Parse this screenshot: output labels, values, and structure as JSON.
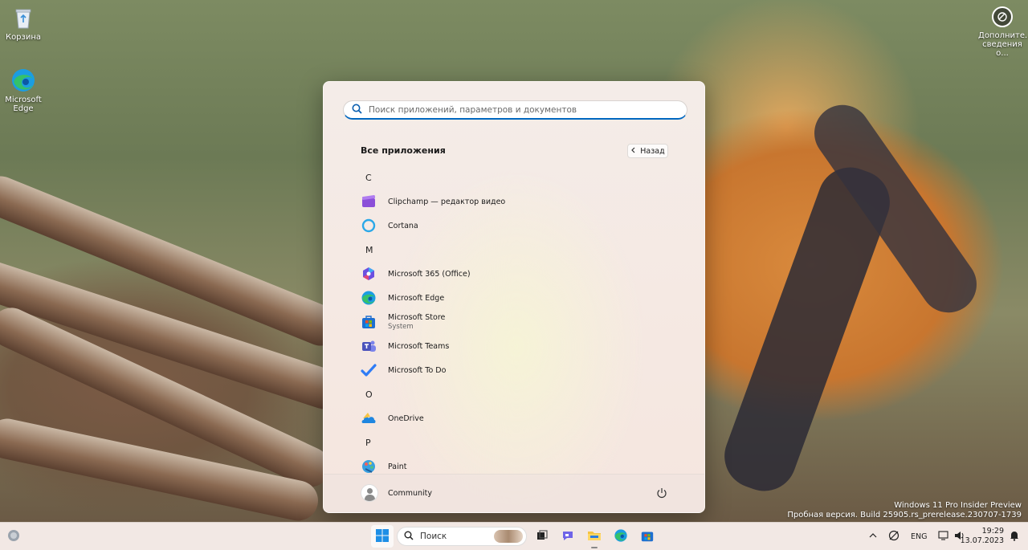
{
  "desktop": {
    "icons": [
      {
        "label": "Корзина"
      },
      {
        "label": "Microsoft Edge"
      }
    ],
    "info_widget": {
      "label": "Дополните... сведения о..."
    },
    "watermark": {
      "line1": "Windows 11 Pro Insider Preview",
      "line2": "Пробная версия. Build 25905.rs_prerelease.230707-1739"
    }
  },
  "start_menu": {
    "search_placeholder": "Поиск приложений, параметров и документов",
    "all_apps_title": "Все приложения",
    "back_label": "Назад",
    "sections": [
      {
        "letter": "C",
        "apps": [
          {
            "name": "Clipchamp — редактор видео",
            "icon": "clipchamp-icon"
          },
          {
            "name": "Cortana",
            "icon": "cortana-icon"
          }
        ]
      },
      {
        "letter": "M",
        "apps": [
          {
            "name": "Microsoft 365 (Office)",
            "icon": "office-icon"
          },
          {
            "name": "Microsoft Edge",
            "icon": "edge-icon"
          },
          {
            "name": "Microsoft Store",
            "sub": "System",
            "icon": "store-icon"
          },
          {
            "name": "Microsoft Teams",
            "icon": "teams-icon"
          },
          {
            "name": "Microsoft To Do",
            "icon": "todo-icon"
          }
        ]
      },
      {
        "letter": "O",
        "apps": [
          {
            "name": "OneDrive",
            "icon": "onedrive-icon"
          }
        ]
      },
      {
        "letter": "P",
        "apps": [
          {
            "name": "Paint",
            "icon": "paint-icon"
          }
        ]
      }
    ],
    "user_name": "Community"
  },
  "taskbar": {
    "search_label": "Поиск",
    "language": "ENG",
    "time": "19:29",
    "date": "13.07.2023"
  },
  "colors": {
    "accent": "#0067c0",
    "start_bg": "#f5e9e3",
    "taskbar_bg": "#f2e8e4"
  }
}
